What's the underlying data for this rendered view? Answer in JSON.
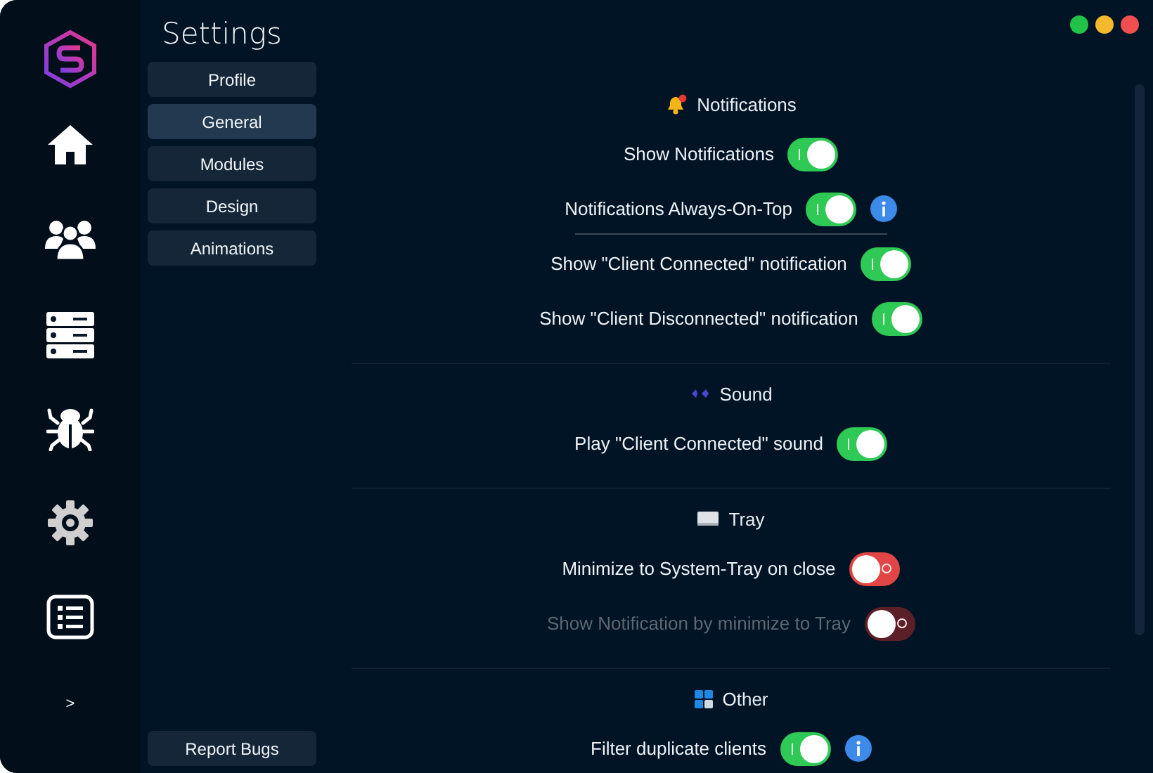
{
  "sidebar": {
    "icons": [
      {
        "kind": "logo"
      },
      {
        "kind": "home"
      },
      {
        "kind": "users"
      },
      {
        "kind": "server"
      },
      {
        "kind": "bug"
      },
      {
        "kind": "gear"
      },
      {
        "kind": "list"
      }
    ],
    "expand": ">"
  },
  "title": "Settings",
  "nav": [
    {
      "label": "Profile",
      "selected": false
    },
    {
      "label": "General",
      "selected": true
    },
    {
      "label": "Modules",
      "selected": false
    },
    {
      "label": "Design",
      "selected": false
    },
    {
      "label": "Animations",
      "selected": false
    }
  ],
  "report_button": "Report Bugs",
  "sections": [
    {
      "title": "Notifications",
      "kind": "bell",
      "rows": [
        {
          "kind": "toggle",
          "label": "Show Notifications",
          "on": true,
          "disabled": false
        },
        {
          "kind": "toggle",
          "label": "Notifications Always-On-Top",
          "on": true,
          "disabled": false,
          "info": true
        },
        {
          "kind": "divider"
        },
        {
          "kind": "toggle",
          "label": "Show \"Client Connected\" notification",
          "on": true,
          "disabled": false
        },
        {
          "kind": "toggle",
          "label": "Show \"Client Disconnected\" notification",
          "on": true,
          "disabled": false
        }
      ]
    },
    {
      "title": "Sound",
      "kind": "sound",
      "rows": [
        {
          "kind": "toggle",
          "label": "Play \"Client Connected\" sound",
          "on": true,
          "disabled": false
        }
      ]
    },
    {
      "title": "Tray",
      "kind": "tray",
      "rows": [
        {
          "kind": "toggle",
          "label": "Minimize to System-Tray on close",
          "on": false,
          "disabled": false
        },
        {
          "kind": "toggle",
          "label": "Show Notification by minimize to Tray",
          "on": false,
          "disabled": true
        }
      ]
    },
    {
      "title": "Other",
      "kind": "grid",
      "rows": [
        {
          "kind": "toggle",
          "label": "Filter duplicate clients",
          "on": true,
          "disabled": false,
          "info": true
        }
      ]
    }
  ]
}
